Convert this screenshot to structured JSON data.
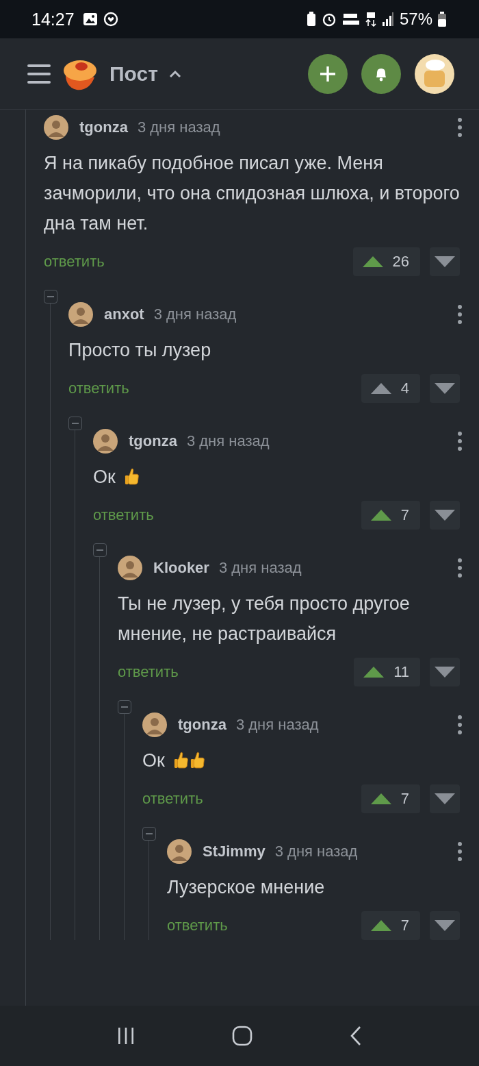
{
  "status_bar": {
    "time": "14:27",
    "battery": "57%"
  },
  "header": {
    "title": "Пост"
  },
  "comments": [
    {
      "user": "tgonza",
      "time": "3 дня назад",
      "text": "Я на пикабу подобное писал уже. Меня зачморили, что она спидозная шлюха, и второго дна там нет.",
      "reply": "ответить",
      "score": "26",
      "upvoted": true,
      "children": [
        {
          "user": "anxot",
          "time": "3 дня назад",
          "text": "Просто ты лузер",
          "reply": "ответить",
          "score": "4",
          "upvoted": false,
          "children": [
            {
              "user": "tgonza",
              "time": "3 дня назад",
              "text": "Ок",
              "emojis": [
                {
                  "kind": "thumbs_up"
                }
              ],
              "reply": "ответить",
              "score": "7",
              "upvoted": true,
              "children": [
                {
                  "user": "Klooker",
                  "time": "3 дня назад",
                  "text": "Ты не лузер, у тебя просто другое мнение, не растраивайся",
                  "reply": "ответить",
                  "score": "11",
                  "upvoted": true,
                  "children": [
                    {
                      "user": "tgonza",
                      "time": "3 дня назад",
                      "text": "Ок",
                      "emojis": [
                        {
                          "kind": "thumbs_up"
                        },
                        {
                          "kind": "thumbs_up"
                        }
                      ],
                      "reply": "ответить",
                      "score": "7",
                      "upvoted": true,
                      "children": [
                        {
                          "user": "StJimmy",
                          "time": "3 дня назад",
                          "text": "Лузерское мнение",
                          "reply": "ответить",
                          "score": "7",
                          "upvoted": true
                        }
                      ]
                    }
                  ]
                }
              ]
            }
          ]
        }
      ]
    }
  ]
}
